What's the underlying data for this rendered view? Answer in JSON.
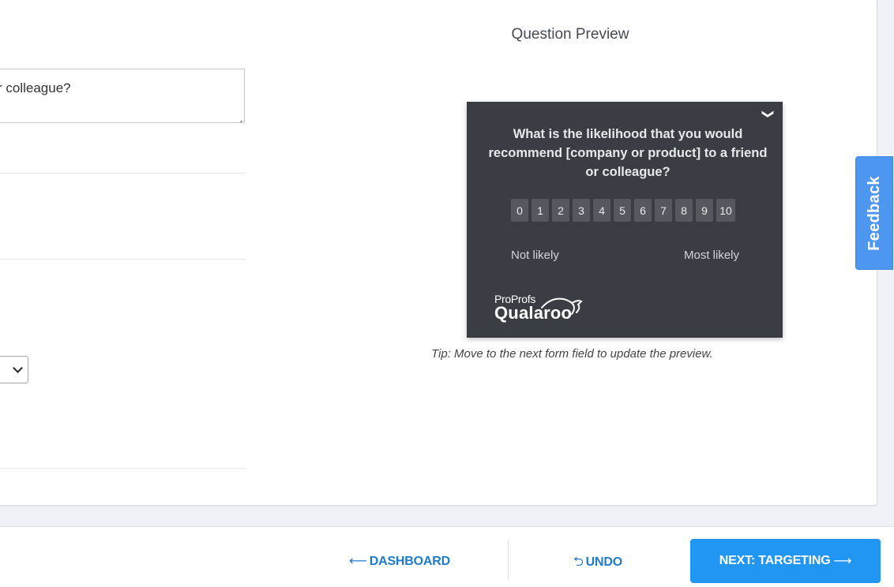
{
  "editor": {
    "question_text_fragment": "r colleague?"
  },
  "preview": {
    "title": "Question Preview",
    "question": "What is the likelihood that you would recommend [company or product] to a friend or colleague?",
    "collapse_icon": "❯",
    "scale": [
      "0",
      "1",
      "2",
      "3",
      "4",
      "5",
      "6",
      "7",
      "8",
      "9",
      "10"
    ],
    "label_low": "Not likely",
    "label_high": "Most likely",
    "brand_top": "ProProfs",
    "brand_bottom": "Qualaroo",
    "tip": "Tip: Move to the next form field to update the preview."
  },
  "feedback_tab": {
    "label": "Feedback"
  },
  "footer": {
    "dashboard_icon": "⟵",
    "dashboard_label": "DASHBOARD",
    "undo_icon": "⮌",
    "undo_label": "UNDO",
    "next_label": "NEXT: TARGETING",
    "next_icon": "⟶"
  },
  "colors": {
    "accent": "#2196f3",
    "link": "#1f7bc8",
    "widget_bg": "#3a3d44",
    "feedback_bg": "#4e97f0"
  }
}
